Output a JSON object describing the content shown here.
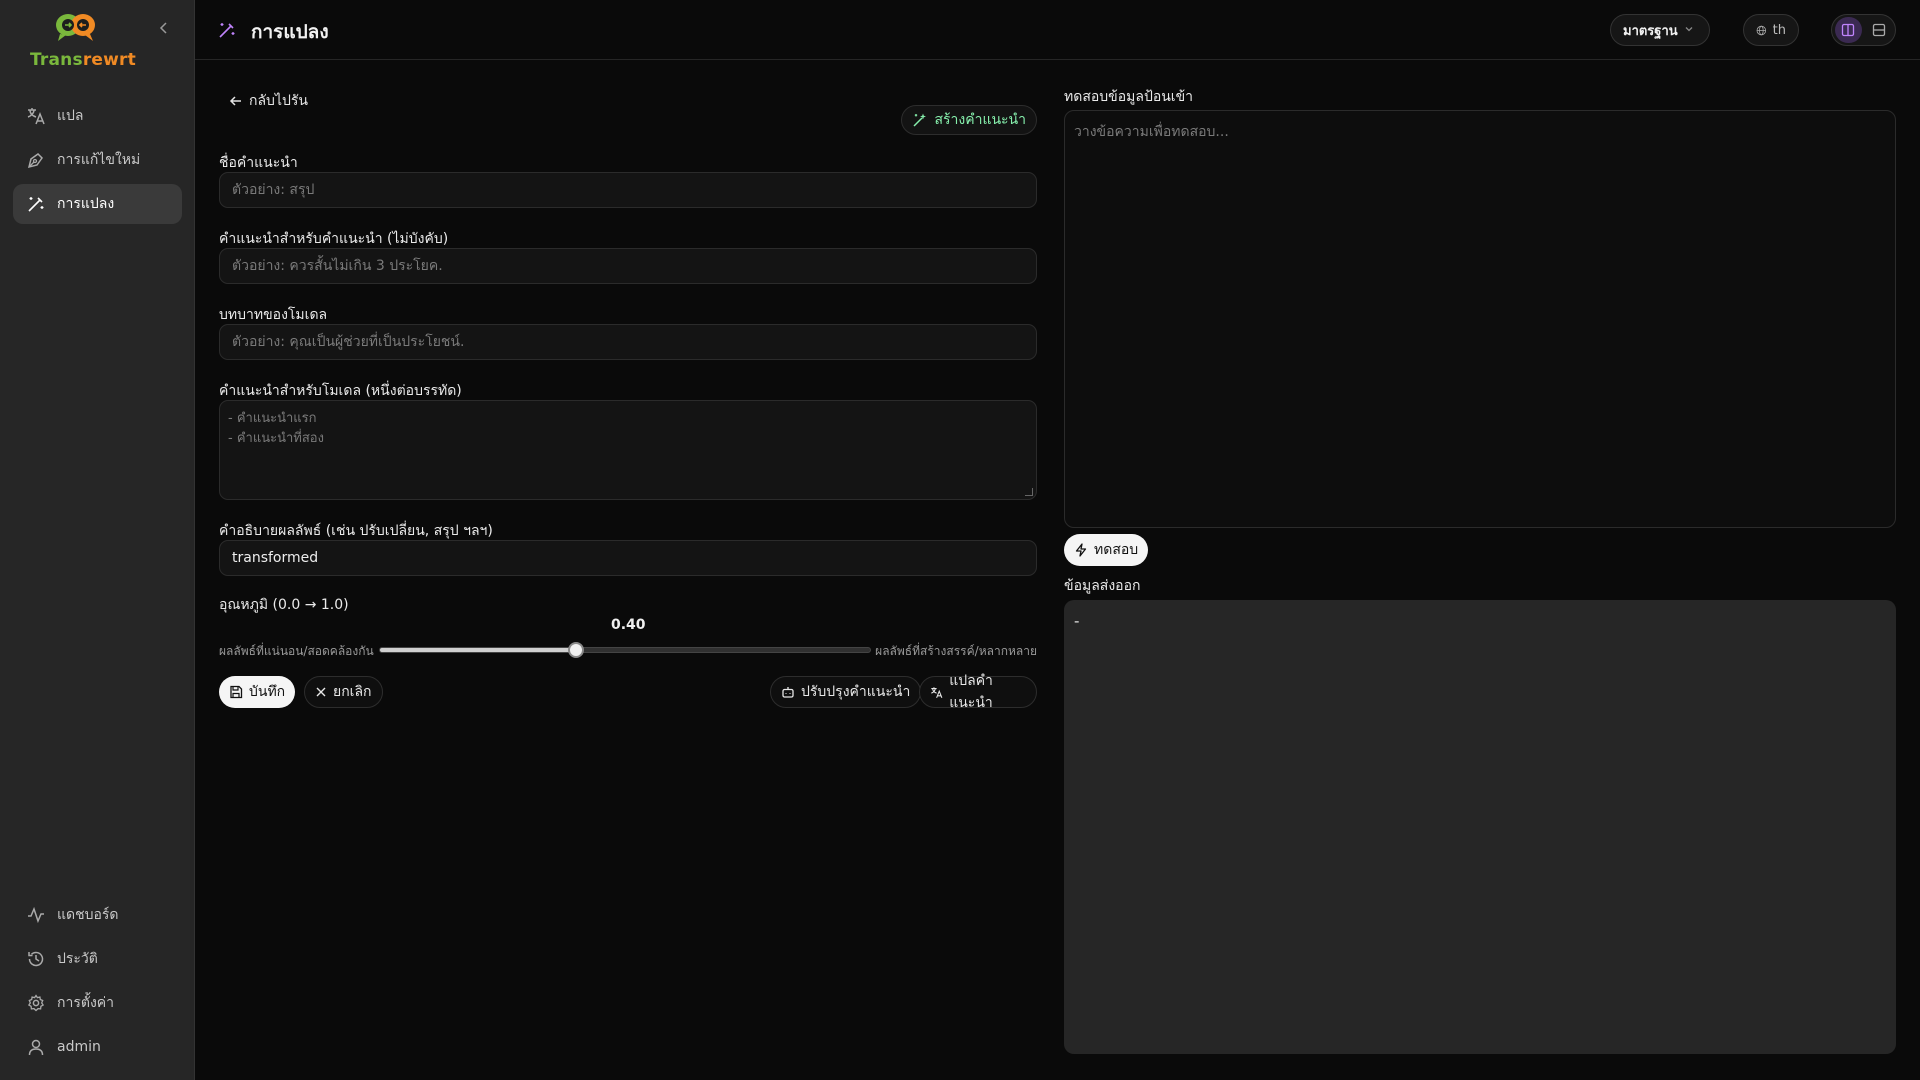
{
  "app": {
    "brand_part1": "Trans",
    "brand_part2": "rewrt"
  },
  "sidebar": {
    "items": [
      {
        "label": "แปล",
        "icon": "translate-icon"
      },
      {
        "label": "การแก้ไขใหม่",
        "icon": "pen-tool-icon"
      },
      {
        "label": "การแปลง",
        "icon": "magic-wand-icon",
        "active": true
      }
    ],
    "bottom_items": [
      {
        "label": "แดชบอร์ด",
        "icon": "activity-icon"
      },
      {
        "label": "ประวัติ",
        "icon": "history-icon"
      },
      {
        "label": "การตั้งค่า",
        "icon": "gear-icon"
      },
      {
        "label": "admin",
        "icon": "user-icon"
      }
    ]
  },
  "header": {
    "title": "การแปลง",
    "mode_select": "มาตรฐาน",
    "language": "th"
  },
  "form": {
    "back_label": "กลับไปรัน",
    "generate_label": "สร้างคำแนะนำ",
    "name_label": "ชื่อคำแนะนำ",
    "name_placeholder": "ตัวอย่าง: สรุป",
    "guide_label": "คำแนะนำสำหรับคำแนะนำ (ไม่บังคับ)",
    "guide_placeholder": "ตัวอย่าง: ควรสั้นไม่เกิน 3 ประโยค.",
    "role_label": "บทบาทของโมเดล",
    "role_placeholder": "ตัวอย่าง: คุณเป็นผู้ช่วยที่เป็นประโยชน์.",
    "instructions_label": "คำแนะนำสำหรับโมเดล (หนึ่งต่อบรรทัด)",
    "instructions_placeholder_line1": "- คำแนะนำแรก",
    "instructions_placeholder_line2": "- คำแนะนำที่สอง",
    "result_label": "คำอธิบายผลลัพธ์ (เช่น ปรับเปลี่ยน, สรุป ฯลฯ)",
    "result_value": "transformed",
    "temperature_label": "อุณหภูมิ (0.0 → 1.0)",
    "temperature_value": "0.40",
    "temperature": 0.4,
    "slider_left_label": "ผลลัพธ์ที่แน่นอน/สอดคล้องกัน",
    "slider_right_label": "ผลลัพธ์ที่สร้างสรรค์/หลากหลาย",
    "save_label": "บันทึก",
    "cancel_label": "ยกเลิก",
    "improve_label": "ปรับปรุงคำแนะนำ",
    "translate_label": "แปลคำแนะนำ"
  },
  "test": {
    "input_label": "ทดสอบข้อมูลป้อนเข้า",
    "input_placeholder": "วางข้อความเพื่อทดสอบ...",
    "test_button": "ทดสอบ",
    "output_label": "ข้อมูลส่งออก",
    "output_value": "-"
  }
}
